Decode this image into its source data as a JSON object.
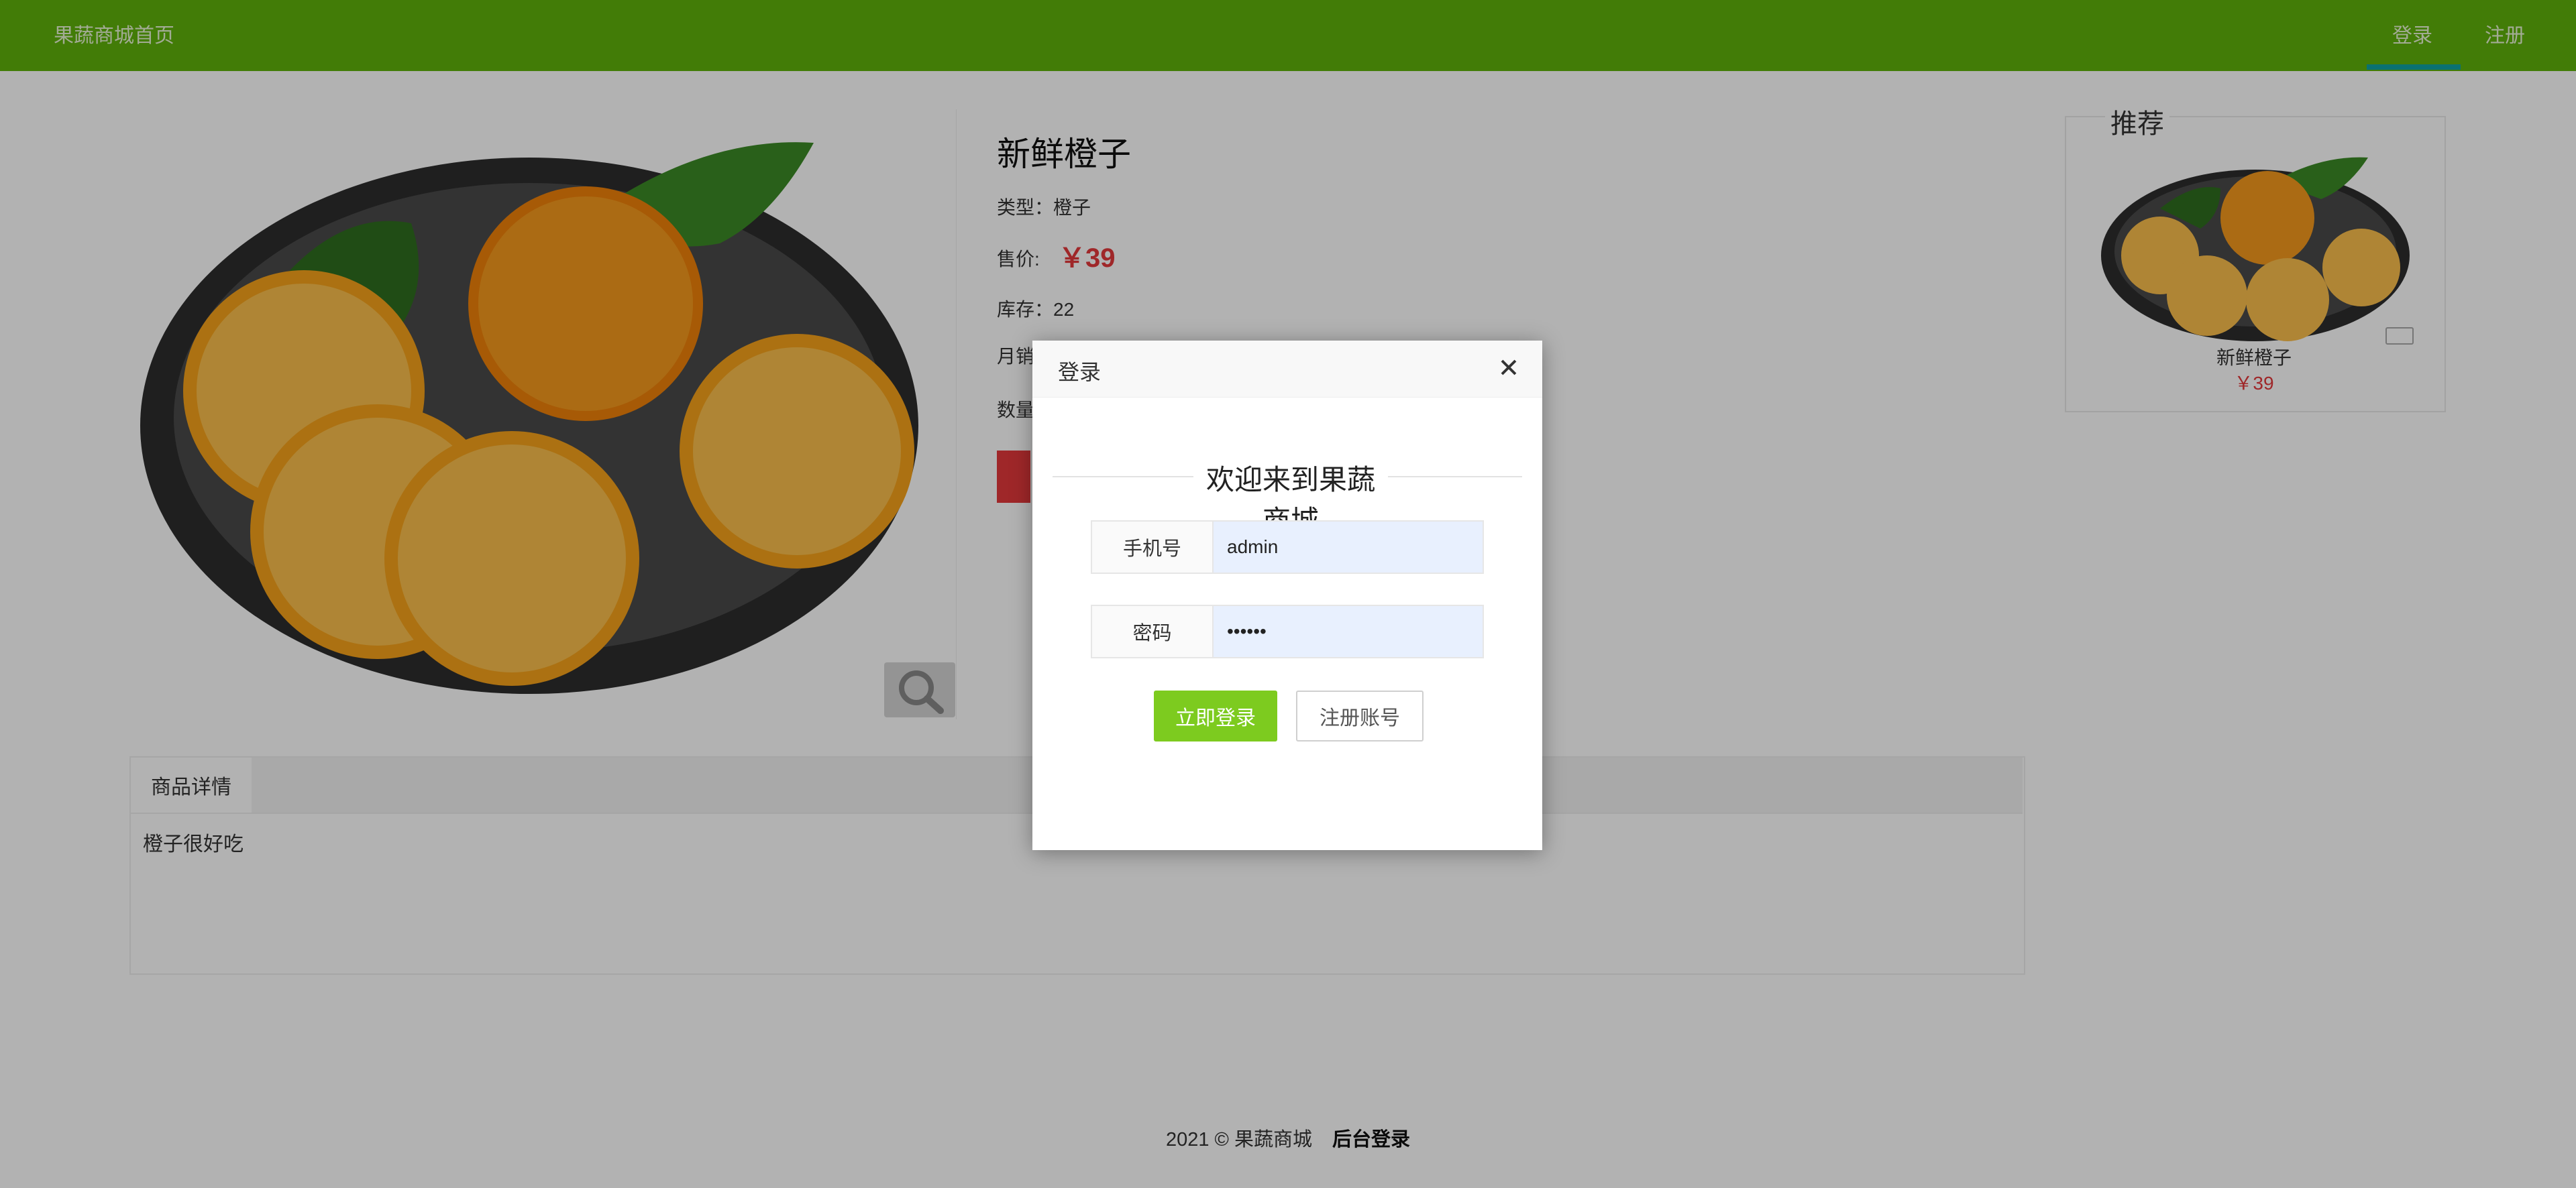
{
  "header": {
    "site_title": "果蔬商城首页",
    "nav_login": "登录",
    "nav_register": "注册"
  },
  "product": {
    "title": "新鲜橙子",
    "type_label": "类型：",
    "type_value": "橙子",
    "price_label": "售价:",
    "price": "￥39",
    "stock_label": "库存：",
    "stock_value": "22",
    "monthly_sales_label": "月销",
    "quantity_label": "数量"
  },
  "detail": {
    "tab_label": "商品详情",
    "text": "橙子很好吃"
  },
  "recommend": {
    "title": "推荐",
    "item_name": "新鲜橙子",
    "item_price": "￥39"
  },
  "footer": {
    "copyright": "2021 © 果蔬商城",
    "admin_link": "后台登录"
  },
  "modal": {
    "title": "登录",
    "welcome": "欢迎来到果蔬商城",
    "phone_label": "手机号",
    "phone_value": "admin",
    "password_label": "密码",
    "password_value": "••••••",
    "login_button": "立即登录",
    "register_button": "注册账号"
  },
  "colors": {
    "header_green": "#5fb20b",
    "price_red": "#e4393c",
    "login_button_green": "#7dcb1f"
  }
}
